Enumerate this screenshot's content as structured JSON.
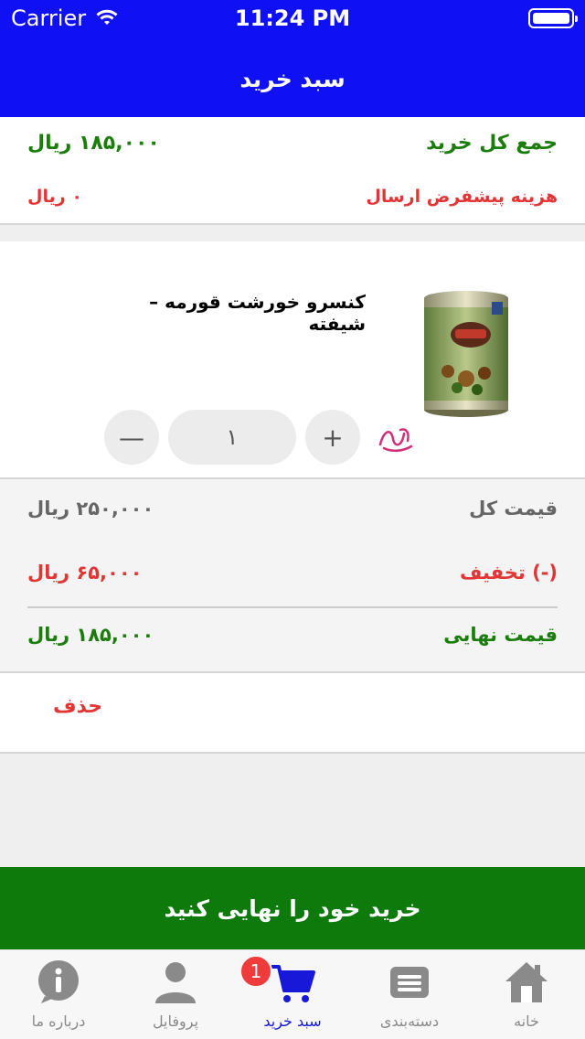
{
  "status_bar": {
    "carrier": "Carrier",
    "time": "11:24 PM"
  },
  "header": {
    "title": "سبد خرید"
  },
  "summary": {
    "total_label": "جمع کل خرید",
    "total_value": "۱۸۵,۰۰۰ ریال",
    "shipping_label": "هزینه پیشفرض ارسال",
    "shipping_value": "۰ ریال"
  },
  "product": {
    "name": "کنسرو خورشت قورمه – شیفته",
    "quantity": "۱",
    "plus_label": "+",
    "minus_label": "—"
  },
  "prices": {
    "total_label": "قیمت کل",
    "total_value": "۲۵۰,۰۰۰ ریال",
    "discount_label": "(-) تخفیف",
    "discount_value": "۶۵,۰۰۰ ریال",
    "final_label": "قیمت نهایی",
    "final_value": "۱۸۵,۰۰۰ ریال"
  },
  "delete_label": "حذف",
  "checkout_label": "خرید خود را نهایی کنید",
  "tabbar": {
    "tabs": [
      {
        "label": "خانه",
        "icon": "home-icon"
      },
      {
        "label": "دسته‌بندی",
        "icon": "category-icon"
      },
      {
        "label": "سبد خرید",
        "icon": "cart-icon",
        "active": true
      },
      {
        "label": "پروفایل",
        "icon": "profile-icon"
      },
      {
        "label": "درباره ما",
        "icon": "info-icon"
      }
    ],
    "cart_badge": "1"
  },
  "colors": {
    "header_bg": "#1010f5",
    "checkout_bg": "#0d7a0b",
    "green_text": "#1b7d0c",
    "red_text": "#e23636",
    "active_tab": "#1818d8"
  }
}
